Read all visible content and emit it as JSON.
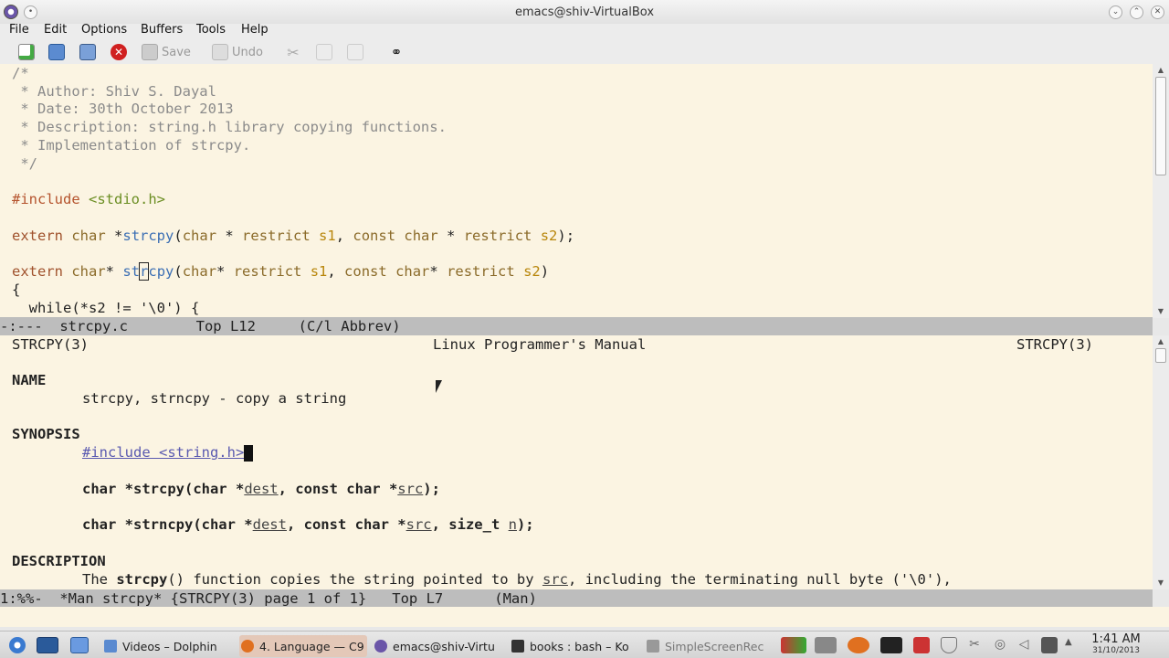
{
  "window": {
    "title": "emacs@shiv-VirtualBox"
  },
  "menu": [
    "File",
    "Edit",
    "Options",
    "Buffers",
    "Tools",
    "Help"
  ],
  "toolbar": {
    "save": "Save",
    "undo": "Undo"
  },
  "code": {
    "c1": "/*",
    "c2": " * Author: Shiv S. Dayal",
    "c3": " * Date: 30th October 2013",
    "c4": " * Description: string.h library copying functions.",
    "c5": " * Implementation of strcpy.",
    "c6": " */",
    "inc": "#include",
    "inc_h": "<stdio.h>",
    "l1": [
      "extern",
      "char",
      "*",
      "strcpy",
      "(",
      "char",
      " * ",
      "restrict",
      "s1",
      "const",
      "char",
      " * ",
      "restrict",
      "s2",
      ");"
    ],
    "l2": [
      "extern",
      "char",
      "* ",
      "st",
      "r",
      "cpy",
      "(",
      "char",
      "* ",
      "restrict",
      "s1",
      "const",
      "char",
      "* ",
      "restrict",
      "s2",
      ")"
    ],
    "brace": "{",
    "while": "  while(*s2 != '\\0') {"
  },
  "modeline1": "-:---  strcpy.c        Top L12     (C/l Abbrev)",
  "man": {
    "hdr_left": "STRCPY(3)",
    "hdr_mid": "Linux Programmer's Manual",
    "hdr_right": "STRCPY(3)",
    "name_h": "NAME",
    "name_t": "strcpy, strncpy - copy a string",
    "syn_h": "SYNOPSIS",
    "syn_inc": "#include <string.h>",
    "p1": [
      "char *strcpy(char *",
      "dest",
      ", const char *",
      "src",
      ");"
    ],
    "p2": [
      "char *strncpy(char *",
      "dest",
      ", const char *",
      "src",
      ", size_t ",
      "n",
      ");"
    ],
    "desc_h": "DESCRIPTION",
    "desc": [
      "The ",
      "strcpy",
      "() function copies the string pointed to by ",
      "src",
      ", including the terminating null byte ('\\0'),"
    ]
  },
  "modeline2": "1:%%-  *Man strcpy* {STRCPY(3) page 1 of 1}   Top L7      (Man)",
  "taskbar": {
    "tasks": [
      "Videos – Dolphin",
      "4. Language — C9",
      "emacs@shiv-Virtu",
      "books : bash – Ko",
      "SimpleScreenRec"
    ],
    "time": "1:41 AM",
    "date": "31/10/2013"
  },
  "colors": {
    "buffer_bg": "#fbf4e2",
    "modeline_bg": "#bdbdbd",
    "comment": "#8b8b8b",
    "keyword": "#a0522d",
    "function": "#3c6fb4"
  }
}
